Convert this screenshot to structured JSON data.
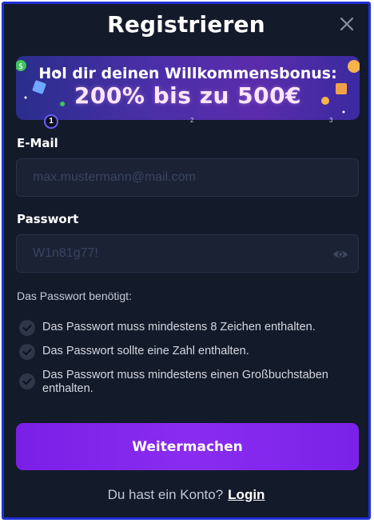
{
  "modal": {
    "title": "Registrieren",
    "close_icon": "close-icon"
  },
  "banner": {
    "line1": "Hol dir deinen Willkommensbonus:",
    "line2": "200% bis zu 500€",
    "steps": [
      "1",
      "2",
      "3"
    ],
    "current_step": 1
  },
  "email": {
    "label": "E-Mail",
    "placeholder": "max.mustermann@mail.com",
    "value": ""
  },
  "password": {
    "label": "Passwort",
    "placeholder": "W1n81g77!",
    "value": "",
    "toggle_icon": "eye-icon"
  },
  "requirements": {
    "title": "Das Passwort benötigt:",
    "items": [
      "Das Passwort muss mindestens 8 Zeichen enthalten.",
      "Das Passwort sollte eine Zahl enthalten.",
      "Das Passwort muss mindestens einen Großbuchstaben enthalten."
    ]
  },
  "submit": {
    "label": "Weitermachen"
  },
  "footer": {
    "text": "Du hast ein Konto?",
    "login_label": "Login"
  },
  "colors": {
    "border": "#1f2fd4",
    "background": "#131a2a",
    "input": "#1a2234",
    "accent": "#7a1fe6"
  }
}
